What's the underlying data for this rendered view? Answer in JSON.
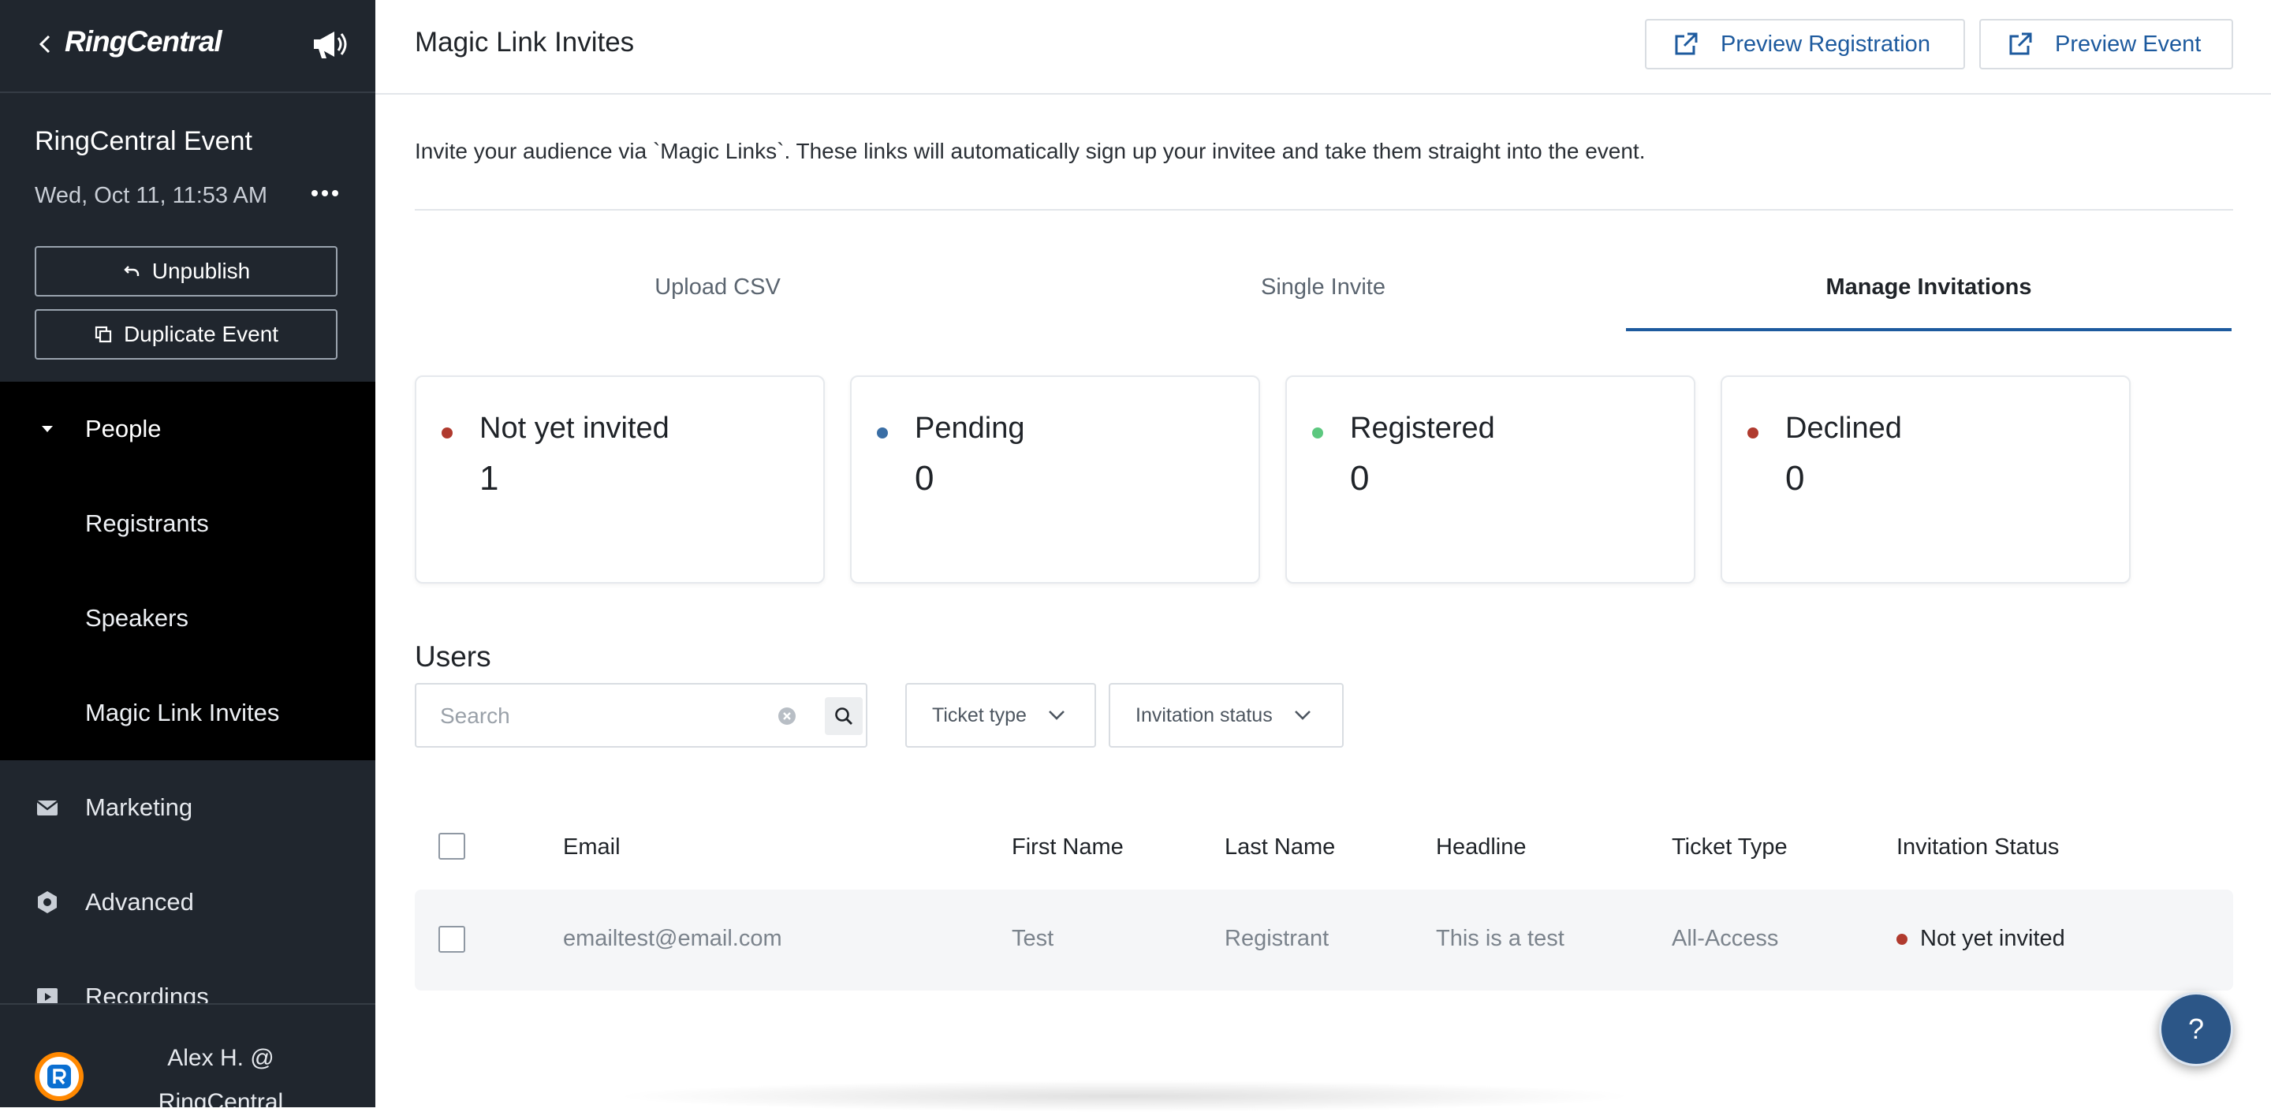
{
  "sidebar": {
    "logo": "RingCentral",
    "event_name": "RingCentral Event",
    "event_date": "Wed, Oct 11, 11:53 AM",
    "unpublish_label": "Unpublish",
    "duplicate_label": "Duplicate Event",
    "people_label": "People",
    "registrants_label": "Registrants",
    "speakers_label": "Speakers",
    "magic_link_label": "Magic Link Invites",
    "marketing_label": "Marketing",
    "advanced_label": "Advanced",
    "recordings_label": "Recordings",
    "user_name": "Alex H. @ RingCentral"
  },
  "header": {
    "title": "Magic Link Invites",
    "preview_registration": "Preview Registration",
    "preview_event": "Preview Event"
  },
  "intro_text": "Invite your audience via `Magic Links`. These links will automatically sign up your invitee and take them straight into the event.",
  "tabs": {
    "upload": "Upload CSV",
    "single": "Single Invite",
    "manage": "Manage Invitations"
  },
  "stats": [
    {
      "label": "Not yet invited",
      "value": "1",
      "color": "#b03a2e"
    },
    {
      "label": "Pending",
      "value": "0",
      "color": "#3a6ea5"
    },
    {
      "label": "Registered",
      "value": "0",
      "color": "#5cc87f"
    },
    {
      "label": "Declined",
      "value": "0",
      "color": "#b03a2e"
    }
  ],
  "users": {
    "title": "Users",
    "search_placeholder": "Search",
    "filter_ticket": "Ticket type",
    "filter_status": "Invitation status"
  },
  "table": {
    "headers": {
      "email": "Email",
      "first_name": "First Name",
      "last_name": "Last Name",
      "headline": "Headline",
      "ticket_type": "Ticket Type",
      "status": "Invitation Status"
    },
    "rows": [
      {
        "email": "emailtest@email.com",
        "first_name": "Test",
        "last_name": "Registrant",
        "headline": "This is a test",
        "ticket_type": "All-Access",
        "status": "Not yet invited",
        "status_color": "#b03a2e"
      }
    ]
  },
  "help_label": "?",
  "colors": {
    "accent": "#1d5a9e",
    "sidebar_bg": "#20262e",
    "nav_group_bg": "#000000"
  }
}
